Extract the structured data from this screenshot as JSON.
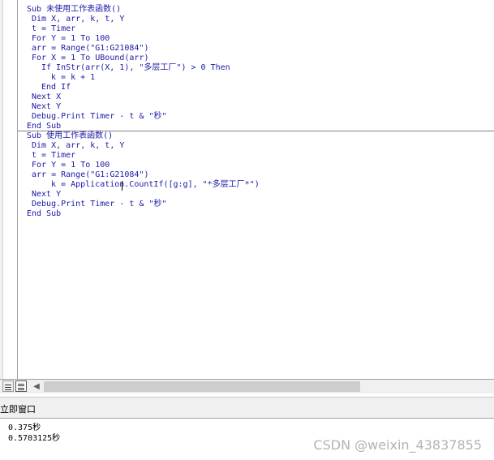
{
  "editor": {
    "procedure_1": [
      "Sub 未使用工作表函数()",
      "Dim X, arr, k, t, Y",
      "t = Timer",
      "For Y = 1 To 100",
      "arr = Range(\"G1:G21084\")",
      "For X = 1 To UBound(arr)",
      "If InStr(arr(X, 1), \"多层工厂\") > 0 Then",
      "k = k + 1",
      "End If",
      "Next X",
      "Next Y",
      "Debug.Print Timer - t & \"秒\"",
      "End Sub"
    ],
    "procedure_2": [
      "Sub 使用工作表函数()",
      "Dim X, arr, k, t, Y",
      "t = Timer",
      "For Y = 1 To 100",
      "arr = Range(\"G1:G21084\")",
      "k = Application.CountIf([g:g], \"*多层工厂*\")",
      "Next Y",
      "Debug.Print Timer - t & \"秒\"",
      "End Sub"
    ]
  },
  "immediate": {
    "title": "立即窗口",
    "output": [
      "0.375秒",
      "0.5703125秒"
    ]
  },
  "watermark": "CSDN @weixin_43837855",
  "colors": {
    "code_text": "#1a1aa8",
    "panel_bg": "#f0f0f0",
    "scroll_thumb": "#cdcdcd"
  }
}
